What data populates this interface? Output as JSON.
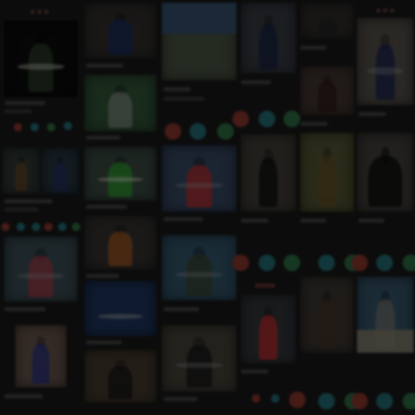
{
  "screen": {
    "description_hidden": "",
    "buttons": {
      "nope_icon": "x-icon",
      "super_icon": "star-icon",
      "like_icon": "heart-icon"
    },
    "colors": {
      "nope": "#7a2f26",
      "super": "#1f5f66",
      "like": "#27603a",
      "background": "#161616"
    }
  }
}
